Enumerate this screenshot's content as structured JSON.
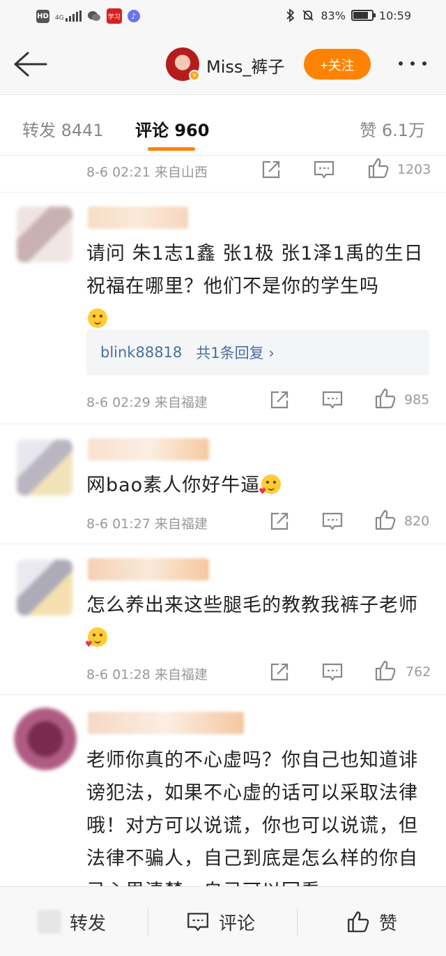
{
  "status_bar": {
    "hd": "HD",
    "network": "4G",
    "red_app": "学习",
    "battery": "83%",
    "battery_level": 0.83,
    "time": "10:59"
  },
  "header": {
    "username": "Miss_裤子",
    "follow_label": "+关注"
  },
  "tabs": {
    "repost": "转发 8441",
    "comment": "评论 960",
    "like": "赞 6.1万"
  },
  "comments": [
    {
      "meta": "8-6 02:21  来自山西",
      "likes": "1203"
    },
    {
      "text": "请问 朱1志1鑫 张1极 张1泽1禹的生日祝福在哪里？他们不是你的学生吗",
      "reply_user": "blink88818",
      "reply_count": "共1条回复",
      "meta": "8-6 02:29  来自福建",
      "likes": "985"
    },
    {
      "text": "网bao素人你好牛逼",
      "meta": "8-6 01:27  来自福建",
      "likes": "820"
    },
    {
      "text": "怎么养出来这些腿毛的教教我裤子老师",
      "meta": "8-6 01:28  来自福建",
      "likes": "762"
    },
    {
      "text": "老师你真的不心虚吗？你自己也知道诽谤犯法，如果不心虚的话可以采取法律哦！对方可以说谎，你也可以说谎，但法律不骗人，自己到底是怎么样的你自己心里清楚。自己可以回看"
    }
  ],
  "bottom_bar": {
    "repost": "转发",
    "comment": "评论",
    "like": "赞"
  },
  "colors": {
    "accent": "#ff8200",
    "link": "#4a6e9e",
    "meta": "#999999"
  }
}
